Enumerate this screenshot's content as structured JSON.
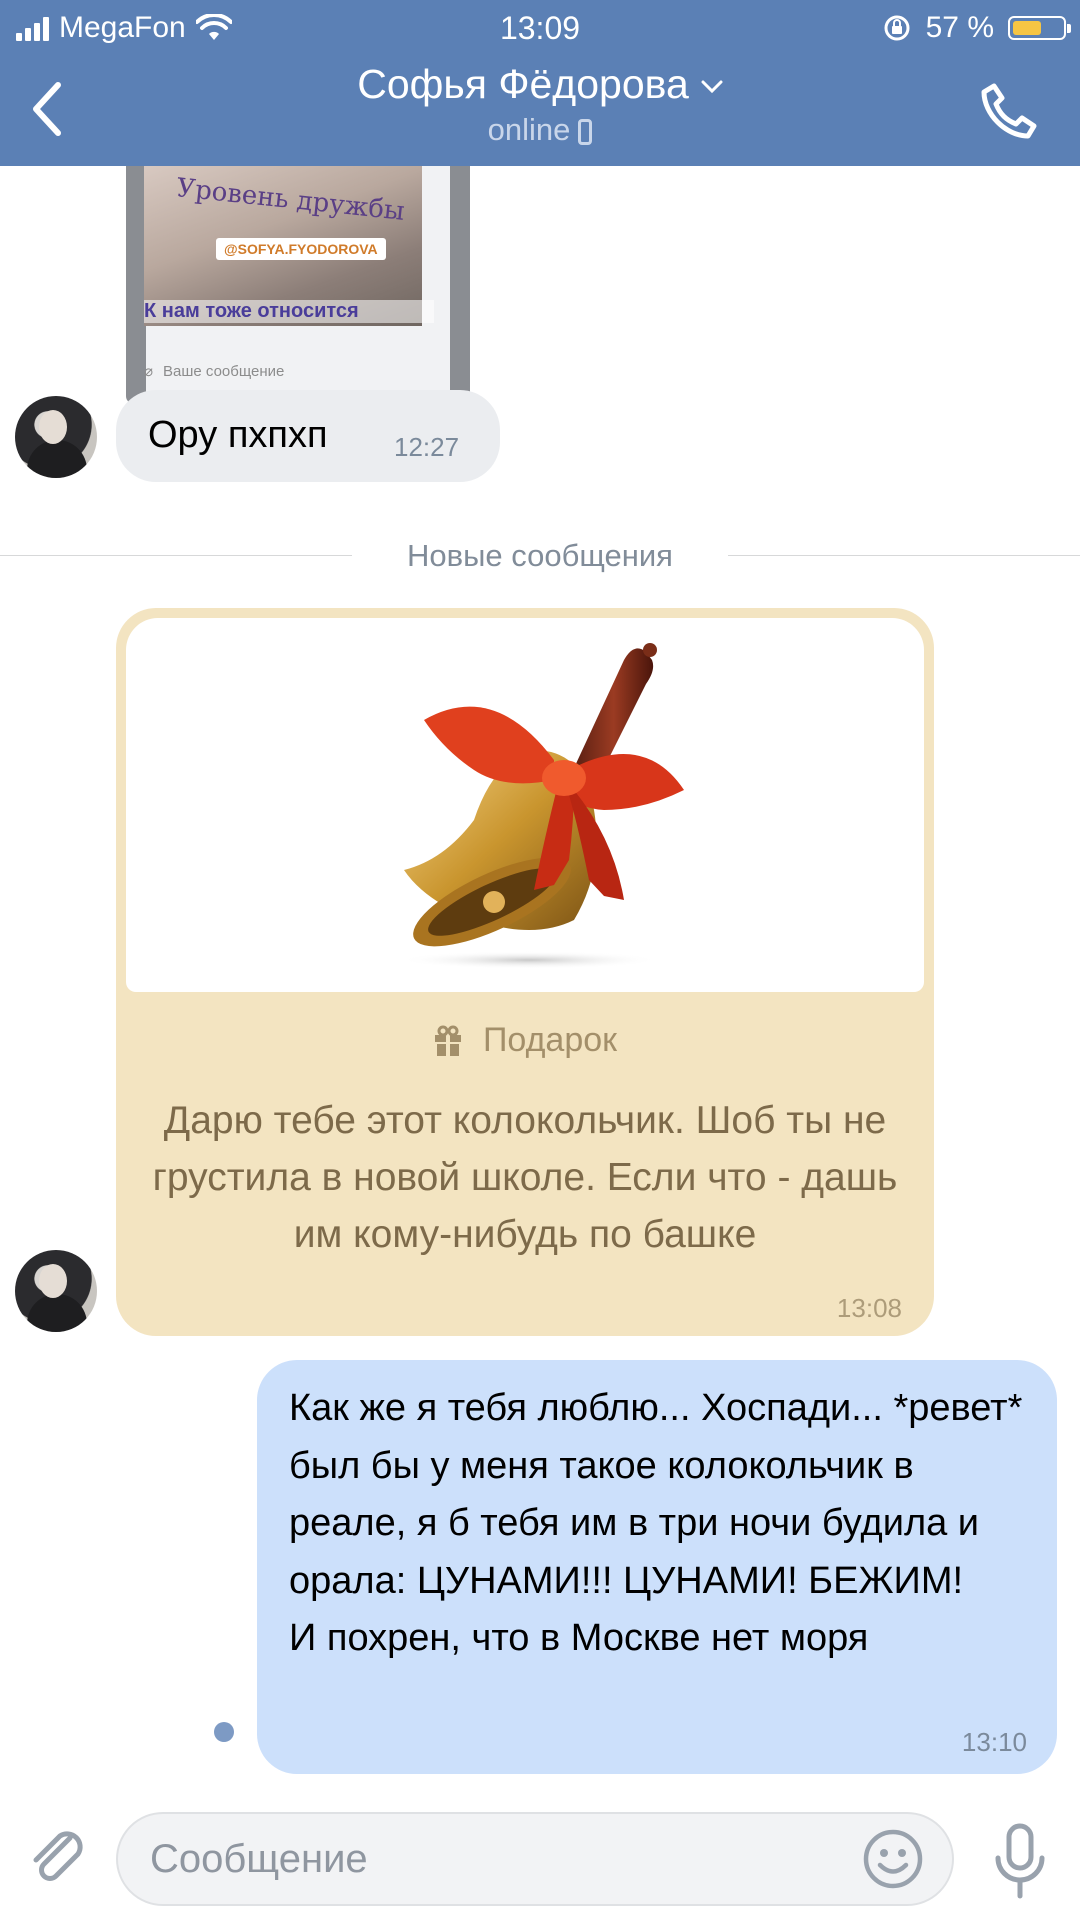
{
  "status_bar": {
    "carrier": "MegaFon",
    "time": "13:09",
    "battery_percent": "57 %",
    "battery_level": 0.57,
    "battery_color": "#f6c544"
  },
  "header": {
    "contact_name": "Софья Фёдорова",
    "status": "online",
    "back_icon": "chevron-left-icon",
    "call_icon": "phone-icon",
    "background_color": "#5b80b5"
  },
  "messages": {
    "story_preview": {
      "title_text": "Уровень дружбы",
      "tag": "@SOFYA.FYODOROVA",
      "caption": "К нам тоже относится",
      "input_placeholder": "Ваше сообщение"
    },
    "incoming_1": {
      "text": "Ору пхпхп",
      "time": "12:27"
    },
    "new_messages_divider": "Новые сообщения",
    "gift": {
      "label": "Подарок",
      "text": "Дарю тебе этот колокольчик. Шоб ты не грустила в новой школе. Если что - дашь им кому-нибудь по башке",
      "time": "13:08",
      "image": "bell-with-red-bow"
    },
    "outgoing_1": {
      "text": "Как же я тебя люблю... Хоспади... *ревет* был бы у меня такое колокольчик в реале, я б тебя им в три ночи будила и орала: ЦУНАМИ!!! ЦУНАМИ! БЕЖИМ!\nИ похрен, что в Москве нет моря",
      "time": "13:10",
      "bubble_color": "#cce0fb"
    }
  },
  "composer": {
    "placeholder": "Сообщение",
    "attach_icon": "paperclip-icon",
    "emoji_icon": "smile-icon",
    "mic_icon": "microphone-icon"
  }
}
